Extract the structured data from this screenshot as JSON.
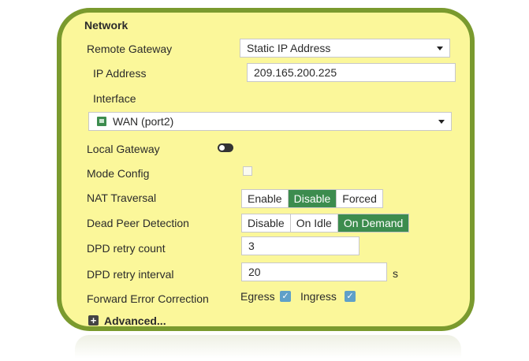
{
  "section": {
    "title": "Network"
  },
  "remote_gateway": {
    "label": "Remote Gateway",
    "value": "Static IP Address"
  },
  "ip_address": {
    "label": "IP Address",
    "value": "209.165.200.225"
  },
  "interface": {
    "label": "Interface",
    "value": "WAN (port2)"
  },
  "local_gateway": {
    "label": "Local Gateway",
    "enabled": false
  },
  "mode_config": {
    "label": "Mode Config",
    "checked": false
  },
  "nat_traversal": {
    "label": "NAT Traversal",
    "options": [
      "Enable",
      "Disable",
      "Forced"
    ],
    "selected": "Disable"
  },
  "dead_peer_detection": {
    "label": "Dead Peer Detection",
    "options": [
      "Disable",
      "On Idle",
      "On Demand"
    ],
    "selected": "On Demand"
  },
  "dpd_retry_count": {
    "label": "DPD retry count",
    "value": "3"
  },
  "dpd_retry_interval": {
    "label": "DPD retry interval",
    "value": "20",
    "unit": "s"
  },
  "fec": {
    "label": "Forward Error Correction",
    "egress_label": "Egress",
    "egress_checked": true,
    "ingress_label": "Ingress",
    "ingress_checked": true
  },
  "advanced": {
    "label": "Advanced..."
  },
  "colors": {
    "panel_bg": "#fbf79a",
    "panel_border": "#7a9a2e",
    "active_segment": "#3c8c4e",
    "checkbox": "#5fa0c8"
  },
  "icons": {
    "interface": "network-port-icon",
    "dropdown": "chevron-down-icon",
    "advanced": "plus-icon",
    "checkbox": "check-icon"
  }
}
